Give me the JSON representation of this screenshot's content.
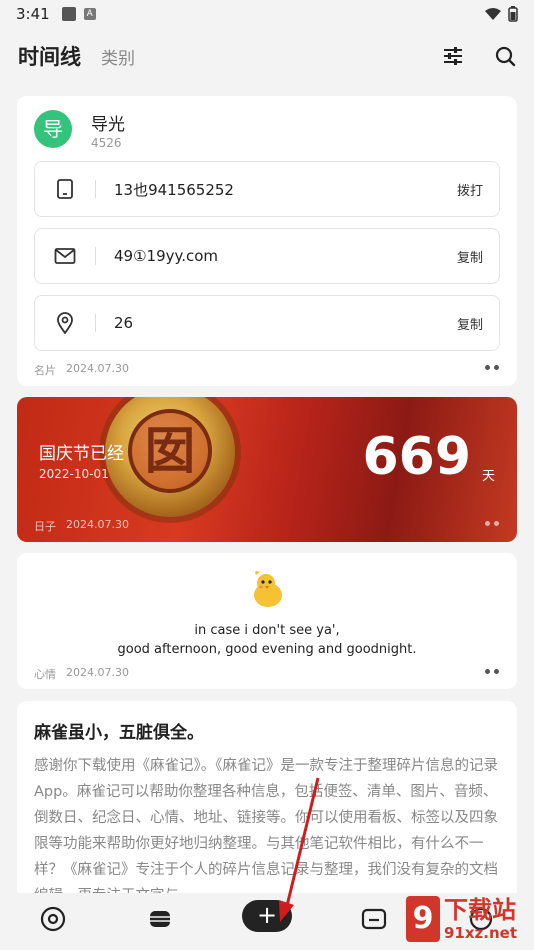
{
  "status_bar": {
    "time": "3:41",
    "badge": "A"
  },
  "header": {
    "tab_active": "时间线",
    "tab_inactive": "类别"
  },
  "contact_card": {
    "avatar_letter": "导",
    "name": "导光",
    "number": "4526",
    "phone": {
      "value": "13也941565252",
      "action": "拨打"
    },
    "email": {
      "value": "49①19yy.com",
      "action": "复制"
    },
    "address": {
      "value": "26",
      "action": "复制"
    },
    "meta_type": "名片",
    "meta_date": "2024.07.30"
  },
  "anniversary_card": {
    "seal_char": "囡",
    "title": "国庆节已经",
    "date": "2022-10-01",
    "count": "669",
    "unit": "天",
    "meta_type": "日子",
    "meta_date": "2024.07.30"
  },
  "mood_card": {
    "line1": "in case i don't see ya',",
    "line2": "good afternoon, good evening and goodnight.",
    "meta_type": "心情",
    "meta_date": "2024.07.30"
  },
  "article_card": {
    "title": "麻雀虽小，五脏俱全。",
    "body": "感谢你下载使用《麻雀记》。《麻雀记》是一款专注于整理碎片信息的记录App。麻雀记可以帮助你整理各种信息，包括便签、清单、图片、音频、倒数日、纪念日、心情、地址、链接等。你可以使用看板、标签以及四象限等功能来帮助你更好地归纳整理。与其他笔记软件相比，有什么不一样？《麻雀记》专注于个人的碎片信息记录与整理，我们没有复杂的文档编辑，更专注于文字与..."
  },
  "bottom_nav": {
    "add_label": "+"
  },
  "watermark": {
    "logo": "9",
    "text": "下载站",
    "url": "91xz.net"
  },
  "colors": {
    "accent_green": "#34c37a",
    "anniv_red": "#c12a16",
    "dark": "#232323",
    "watermark_red": "#d1362b"
  }
}
